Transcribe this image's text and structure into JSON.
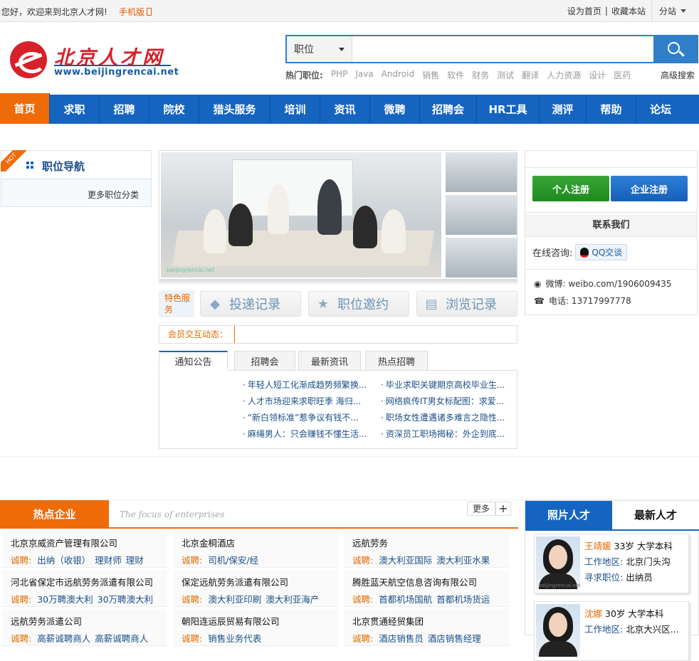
{
  "topbar": {
    "greeting": "您好，欢迎来到北京人才网!",
    "mobile": "手机版",
    "set_home": "设为首页",
    "bookmark": "收藏本站",
    "branch": "分站"
  },
  "logo": {
    "cn": "北京人才网",
    "url": "www.beijingrencai.net"
  },
  "search": {
    "category": "职位",
    "placeholder": "",
    "hot_label": "热门职位:",
    "hot": [
      "PHP",
      "Java",
      "Android",
      "销售",
      "软件",
      "财务",
      "测试",
      "翻译",
      "人力资源",
      "设计",
      "医药"
    ],
    "advanced": "高级搜索"
  },
  "nav": [
    "首页",
    "求职",
    "招聘",
    "院校",
    "猎头服务",
    "培训",
    "资讯",
    "微聘",
    "招聘会",
    "HR工具",
    "测评",
    "帮助",
    "论坛"
  ],
  "left": {
    "hot": "HOT",
    "title": "职位导航",
    "more": "更多职位分类"
  },
  "photo": {
    "watermark": "beijingrencai.net"
  },
  "feature": {
    "label": "特色服务",
    "buttons": [
      "投递记录",
      "职位邀约",
      "浏览记录"
    ]
  },
  "member": {
    "tag": "会员交互动态："
  },
  "news_tabs": [
    "通知公告",
    "招聘会",
    "最新资讯",
    "热点招聘"
  ],
  "news": {
    "left": [
      "年轻人短工化渐成趋势频繁换...",
      "人才市场迎来求职旺季 海归...",
      "“新白领标准”惹争议有钱不...",
      "麻绳男人：只会赚钱不懂生活..."
    ],
    "right": [
      "毕业求职关键期京高校毕业生...",
      "网络疯传IT男女标配图：求爱...",
      "职场女性遭遇诸多难言之隐性...",
      "资深员工职场揭秘：外企到底..."
    ]
  },
  "right": {
    "personal_reg": "个人注册",
    "company_reg": "企业注册",
    "contact": "联系我们",
    "online": "在线咨询:",
    "qq": "QQ交谈",
    "weibo": "微博: weibo.com/1906009435",
    "phone": "电话: 13717997778"
  },
  "hot_enterprises": {
    "title": "热点企业",
    "subtitle": "The focus of enterprises",
    "more": "更多",
    "plus": "+",
    "hiring_label": "诚聘:",
    "companies": [
      {
        "name": "北京京威资产管理有限公司",
        "jobs": [
          "出纳（收银）",
          "理财师",
          "理财"
        ]
      },
      {
        "name": "北京金桐酒店",
        "jobs": [
          "司机/保安/经"
        ]
      },
      {
        "name": "远航劳务",
        "jobs": [
          "澳大利亚国际",
          "澳大利亚水果"
        ]
      },
      {
        "name": "河北省保定市远航劳务派遣有限公司",
        "jobs": [
          "30万聘澳大利",
          "30万聘澳大利"
        ]
      },
      {
        "name": "保定远航劳务派遣有限公司",
        "jobs": [
          "澳大利亚印刷",
          "澳大利亚海产"
        ]
      },
      {
        "name": "腾胜蓝天航空信息咨询有限公司",
        "jobs": [
          "首都机场国航",
          "首都机场货运"
        ]
      },
      {
        "name": "远航劳务派遣公司",
        "jobs": [
          "高薪诚聘商人",
          "高薪诚聘商人"
        ]
      },
      {
        "name": "朝阳连运辰贸易有限公司",
        "jobs": [
          "销售业务代表"
        ]
      },
      {
        "name": "北京贯通经贸集团",
        "jobs": [
          "酒店销售员",
          "酒店销售经理"
        ]
      }
    ]
  },
  "talent": {
    "tab_photo": "照片人才",
    "tab_new": "最新人才",
    "area_label": "工作地区:",
    "seek_label": "寻求职位:",
    "people": [
      {
        "name": "王靖媛",
        "age": "33岁",
        "edu": "大学本科",
        "area": "北京门头沟",
        "seek": "出纳员",
        "photo_mark": "beijingrencai.net"
      },
      {
        "name": "沈娜",
        "age": "30岁",
        "edu": "大学本科",
        "area": "北京大兴区...",
        "seek": ""
      }
    ]
  },
  "colors": {
    "nav_blue": "#1565c0",
    "accent_orange": "#ee6b0a",
    "link_blue": "#1b4f8a"
  }
}
